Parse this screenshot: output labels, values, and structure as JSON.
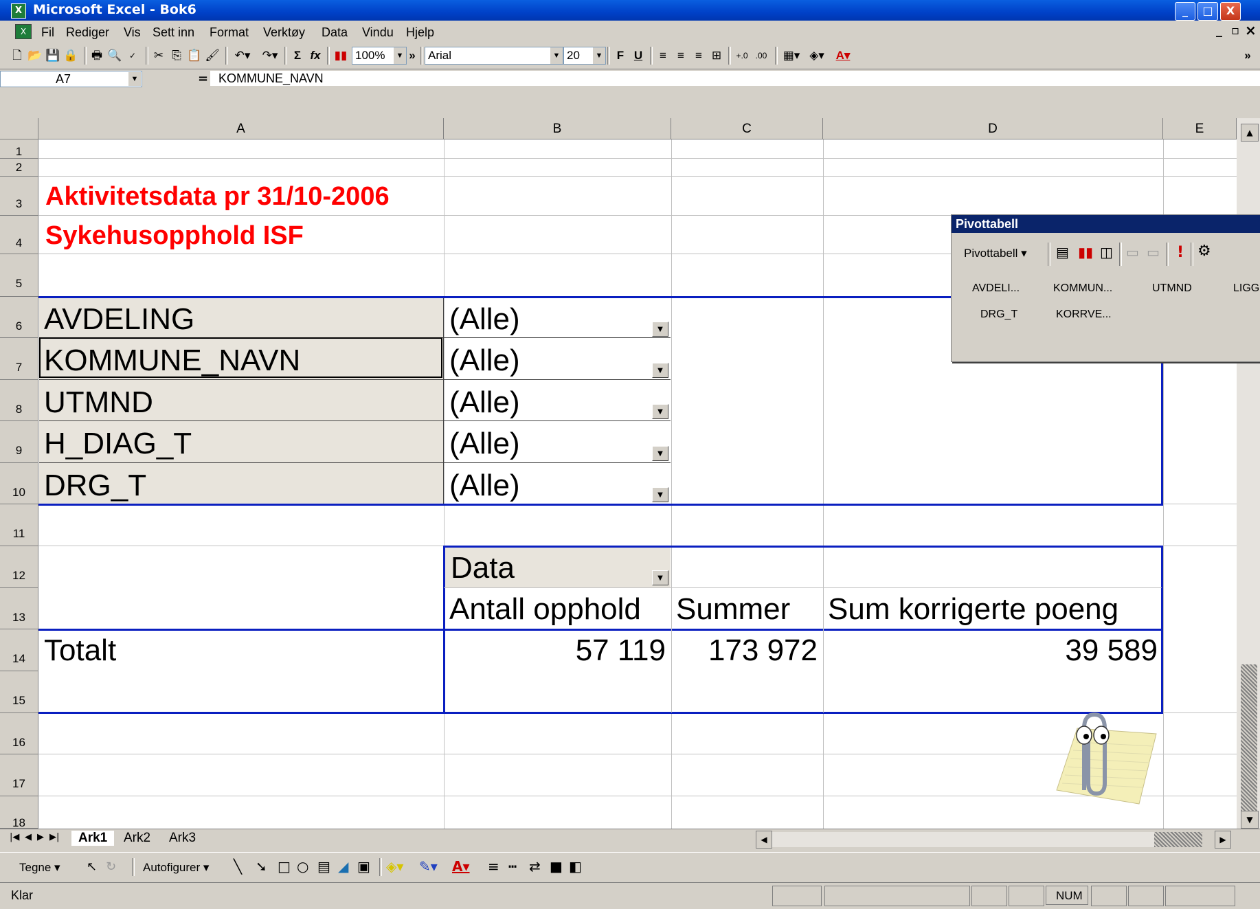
{
  "window": {
    "title": "Microsoft Excel - Bok6",
    "minimize": "_",
    "maximize": "□",
    "close": "X"
  },
  "menu": [
    "Fil",
    "Rediger",
    "Vis",
    "Sett inn",
    "Format",
    "Verktøy",
    "Data",
    "Vindu",
    "Hjelp"
  ],
  "doc_controls": {
    "minimize": "_",
    "restore": "▫",
    "close": "×"
  },
  "toolbar": {
    "zoom": "100%",
    "font": "Arial",
    "font_size": "20",
    "bold": "F",
    "underline": "U",
    "more": "»"
  },
  "formula_bar": {
    "cell_ref": "A7",
    "equals": "=",
    "content": "KOMMUNE_NAVN"
  },
  "columns": [
    "A",
    "B",
    "C",
    "D",
    "E"
  ],
  "rows": [
    "1",
    "2",
    "3",
    "4",
    "5",
    "6",
    "7",
    "8",
    "9",
    "10",
    "11",
    "12",
    "13",
    "14",
    "15",
    "16",
    "17",
    "18"
  ],
  "sheet": {
    "title1": "Aktivitetsdata pr 31/10-2006",
    "title2": "Sykehusopphold ISF",
    "filters": [
      {
        "field": "AVDELING",
        "value": "(Alle)"
      },
      {
        "field": "KOMMUNE_NAVN",
        "value": "(Alle)"
      },
      {
        "field": "UTMND",
        "value": "(Alle)"
      },
      {
        "field": "H_DIAG_T",
        "value": "(Alle)"
      },
      {
        "field": "DRG_T",
        "value": "(Alle)"
      }
    ],
    "data_label": "Data",
    "headers": [
      "Antall opphold",
      "Summer",
      "Sum korrigerte poeng"
    ],
    "total_label": "Totalt",
    "totals": [
      "57 119",
      "173 972",
      "39 589"
    ]
  },
  "pivot_toolbar": {
    "title": "Pivottabell",
    "menu_label": "Pivottabell ▾",
    "fields": [
      "AVDELI...",
      "KOMMUN...",
      "UTMND",
      "LIGG",
      "DRG_T",
      "KORRVE..."
    ]
  },
  "sheet_tabs": [
    "Ark1",
    "Ark2",
    "Ark3"
  ],
  "draw_toolbar": {
    "tegne": "Tegne ▾",
    "autofigurer": "Autofigurer ▾"
  },
  "status": {
    "left": "Klar",
    "num": "NUM"
  }
}
